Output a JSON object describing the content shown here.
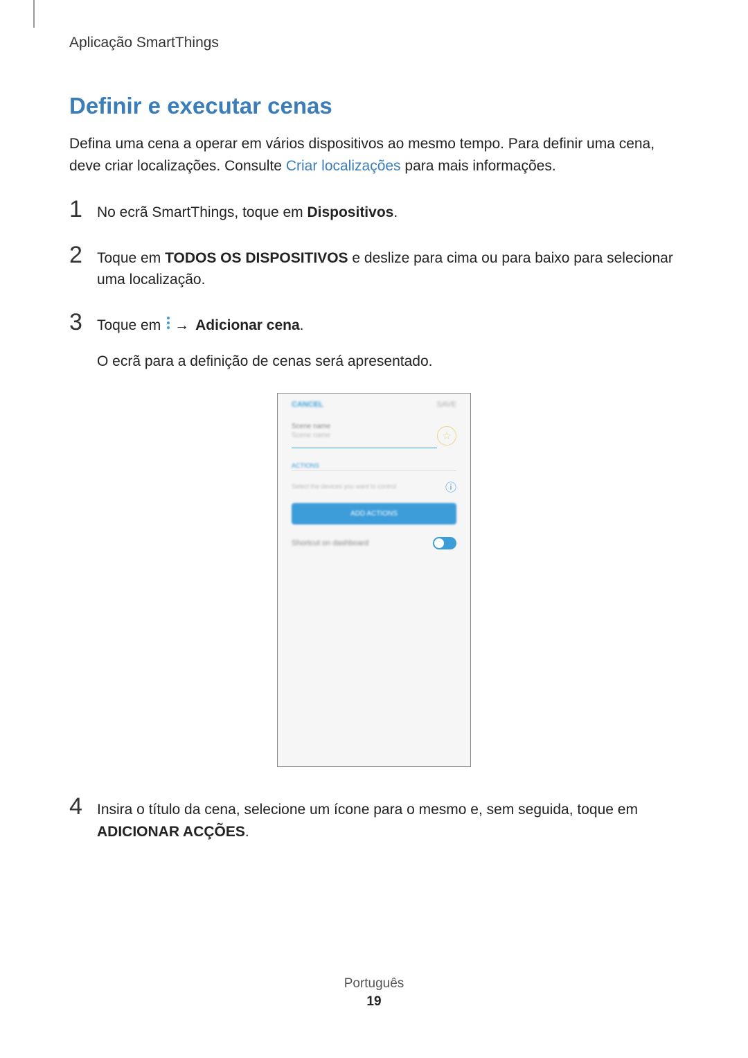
{
  "header": "Aplicação SmartThings",
  "section_title": "Definir e executar cenas",
  "intro": {
    "part1": "Defina uma cena a operar em vários dispositivos ao mesmo tempo. Para definir uma cena, deve criar localizações. Consulte ",
    "link": "Criar localizações",
    "part2": " para mais informações."
  },
  "steps": {
    "s1": {
      "number": "1",
      "prefix": "No ecrã SmartThings, toque em ",
      "bold": "Dispositivos",
      "suffix": "."
    },
    "s2": {
      "number": "2",
      "prefix": "Toque em ",
      "bold": "TODOS OS DISPOSITIVOS",
      "suffix": " e deslize para cima ou para baixo para selecionar uma localização."
    },
    "s3": {
      "number": "3",
      "prefix": "Toque em ",
      "arrow": "→",
      "bold": " Adicionar cena",
      "suffix": ".",
      "sub": "O ecrã para a definição de cenas será apresentado."
    },
    "s4": {
      "number": "4",
      "prefix": "Insira o título da cena, selecione um ícone para o mesmo e, sem seguida, toque em ",
      "bold": "ADICIONAR ACÇÕES",
      "suffix": "."
    }
  },
  "phone": {
    "cancel": "CANCEL",
    "save": "SAVE",
    "scene_name": "Scene name",
    "scene_placeholder": "Scene name",
    "actions": "ACTIONS",
    "select_devices": "Select the devices you want to control",
    "add_actions": "ADD ACTIONS",
    "shortcut": "Shortcut on dashboard"
  },
  "footer": {
    "language": "Português",
    "page": "19"
  }
}
